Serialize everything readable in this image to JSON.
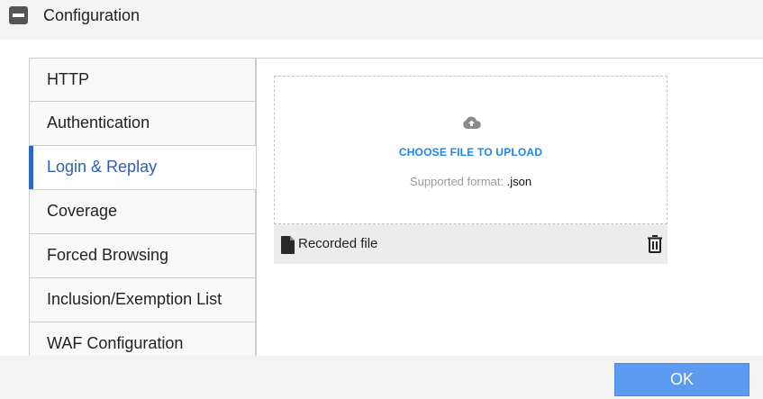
{
  "header": {
    "title": "Configuration",
    "icon": "collapse-icon"
  },
  "sidebar": {
    "items": [
      {
        "label": "HTTP"
      },
      {
        "label": "Authentication"
      },
      {
        "label": "Login & Replay",
        "active": true
      },
      {
        "label": "Coverage"
      },
      {
        "label": "Forced Browsing"
      },
      {
        "label": "Inclusion/Exemption List"
      },
      {
        "label": "WAF Configuration"
      }
    ]
  },
  "upload": {
    "choose_label": "CHOOSE FILE TO UPLOAD",
    "format_label": "Supported format:",
    "format_value": ".json",
    "icon": "cloud-upload-icon"
  },
  "file": {
    "name": "Recorded file",
    "icon": "file-icon",
    "delete_icon": "trash-icon"
  },
  "footer": {
    "ok_label": "OK"
  },
  "colors": {
    "accent": "#2a67c9",
    "link": "#1a87ee",
    "ok_button": "#5b9cf2"
  }
}
